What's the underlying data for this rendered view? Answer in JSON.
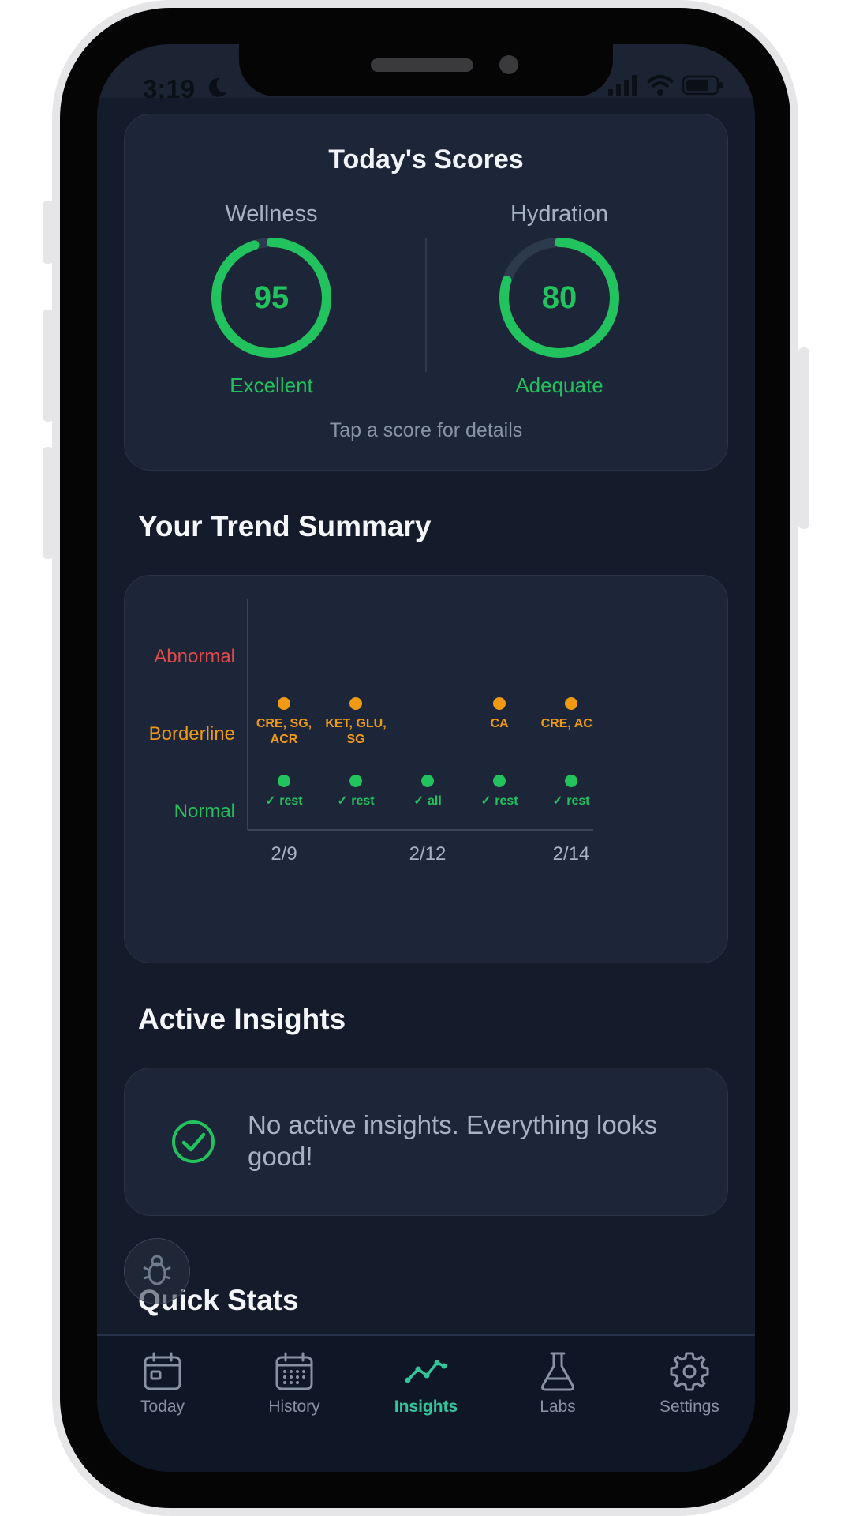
{
  "status_bar": {
    "time": "3:19"
  },
  "scores": {
    "title": "Today's Scores",
    "hint": "Tap a score for details",
    "wellness": {
      "label": "Wellness",
      "value": 95,
      "status": "Excellent"
    },
    "hydration": {
      "label": "Hydration",
      "value": 80,
      "status": "Adequate"
    }
  },
  "trend": {
    "title": "Your Trend Summary",
    "levels": [
      "Abnormal",
      "Borderline",
      "Normal"
    ],
    "level_colors": {
      "Abnormal": "#e24a4a",
      "Borderline": "#f09a14",
      "Normal": "#22c35e"
    },
    "x_ticks": [
      "2/9",
      "2/12",
      "2/14"
    ]
  },
  "chart_data": {
    "type": "scatter",
    "y_levels": [
      "Normal",
      "Borderline",
      "Abnormal"
    ],
    "x_labels_shown": [
      "2/9",
      "2/12",
      "2/14"
    ],
    "points": [
      {
        "col": 0,
        "level": "Borderline",
        "label": "CRE, SG, ACR"
      },
      {
        "col": 0,
        "level": "Normal",
        "label": "✓ rest"
      },
      {
        "col": 1,
        "level": "Borderline",
        "label": "KET, GLU, SG"
      },
      {
        "col": 1,
        "level": "Normal",
        "label": "✓ rest"
      },
      {
        "col": 2,
        "level": "Normal",
        "label": "✓ all"
      },
      {
        "col": 3,
        "level": "Borderline",
        "label": "CA"
      },
      {
        "col": 3,
        "level": "Normal",
        "label": "✓ rest"
      },
      {
        "col": 4,
        "level": "Borderline",
        "label": "CRE, ACR"
      },
      {
        "col": 4,
        "level": "Normal",
        "label": "✓ rest"
      }
    ]
  },
  "insights": {
    "title": "Active Insights",
    "empty_message": "No active insights. Everything looks good!"
  },
  "quick_stats": {
    "title": "Quick Stats"
  },
  "tabs": [
    {
      "label": "Today",
      "icon": "calendar-icon",
      "active": false
    },
    {
      "label": "History",
      "icon": "calendar-grid-icon",
      "active": false
    },
    {
      "label": "Insights",
      "icon": "trend-line-icon",
      "active": true
    },
    {
      "label": "Labs",
      "icon": "flask-icon",
      "active": false
    },
    {
      "label": "Settings",
      "icon": "gear-icon",
      "active": false
    }
  ],
  "colors": {
    "accent": "#22c35e",
    "tab_active": "#34c49a",
    "background": "#141c2c",
    "card": "#1c2638"
  }
}
